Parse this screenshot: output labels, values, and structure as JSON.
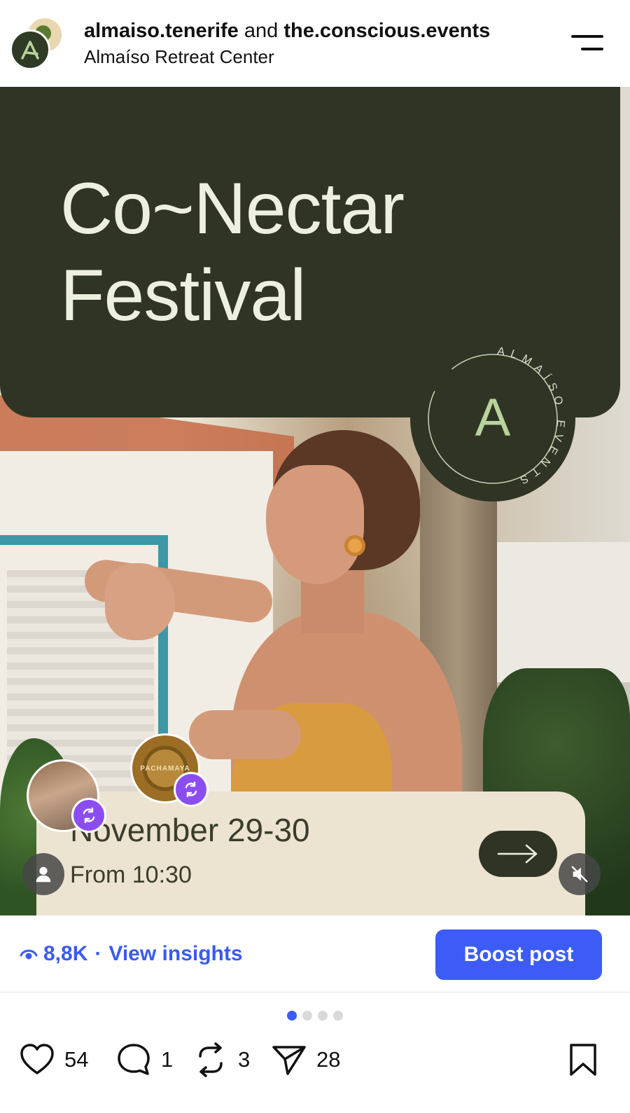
{
  "header": {
    "author_1": "almaiso.tenerife",
    "connector": "and",
    "author_2": "the.conscious.events",
    "location": "Almaíso Retreat Center"
  },
  "post": {
    "title": "Co~Nectar\nFestival",
    "badge_ring_text": "ALMAÍSO EVENTS",
    "badge_letter": "A",
    "date": "November 29-30",
    "time": "From 10:30",
    "pachamaya_label": "PACHAMAYA"
  },
  "insights": {
    "views": "8,8K",
    "separator": "·",
    "link": "View insights",
    "boost_label": "Boost post"
  },
  "carousel": {
    "pages": 4,
    "active_index": 0
  },
  "actions": {
    "likes": "54",
    "comments": "1",
    "reposts": "3",
    "shares": "28"
  },
  "colors": {
    "brand_green": "#2f3424",
    "cream": "#ece3d1",
    "accent_blue": "#3d5cf5",
    "repost_purple": "#8b4df2"
  },
  "icons": [
    "menu-icon",
    "arrow-right-icon",
    "repost-icon",
    "user-tag-icon",
    "mute-icon",
    "eye-icon",
    "heart-icon",
    "comment-icon",
    "share-icon",
    "bookmark-icon"
  ]
}
